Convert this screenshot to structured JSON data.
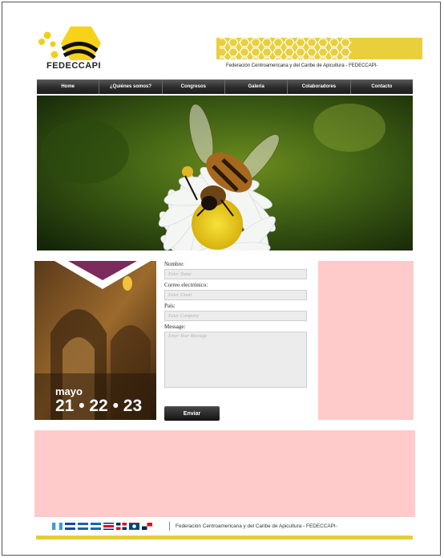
{
  "brand": {
    "name": "FEDECCAPI",
    "tagline": "Federación Centroamericana y del Caribe de Apicultura - FEDECCAPI-"
  },
  "nav": [
    {
      "label": "Home"
    },
    {
      "label": "¿Quiénes somos?"
    },
    {
      "label": "Congresos"
    },
    {
      "label": "Galería"
    },
    {
      "label": "Colaboradores"
    },
    {
      "label": "Contacto"
    }
  ],
  "promo": {
    "month": "mayo",
    "dates": "21 • 22 • 23"
  },
  "form": {
    "name_label": "Nombre:",
    "name_placeholder": "Enter Name",
    "email_label": "Correo electrónico:",
    "email_placeholder": "Enter Email",
    "country_label": "País:",
    "country_placeholder": "Enter Company",
    "message_label": "Message:",
    "message_placeholder": "Enter Your Message",
    "submit_label": "Enviar"
  },
  "footer": {
    "text": "Federación Centroamericana y del Caribe de Apicultura - FEDECCAPI-",
    "flags": [
      "guatemala-flag",
      "el-salvador-flag",
      "honduras-flag",
      "nicaragua-flag",
      "costa-rica-flag",
      "dominican-republic-flag",
      "belize-flag",
      "panama-flag"
    ]
  },
  "colors": {
    "honey": "#e9cf3c",
    "pink_panel": "#fecaca",
    "nav_dark": "#2b2b2b"
  }
}
